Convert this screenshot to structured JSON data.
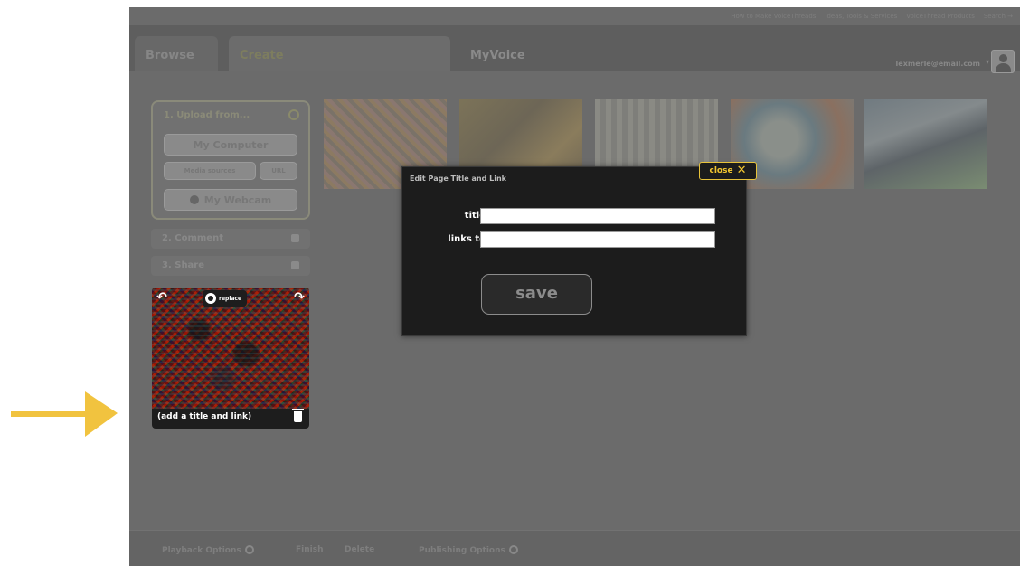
{
  "topbar": {
    "links": [
      "How to Make VoiceThreads",
      "Ideas, Tools & Services",
      "VoiceThread Products",
      "Search →"
    ]
  },
  "tabs": [
    {
      "label": "Browse"
    },
    {
      "label": "Create"
    },
    {
      "label": "MyVoice"
    }
  ],
  "user": {
    "email": "lexmerle@email.com",
    "caret": "▾"
  },
  "upload": {
    "title": "1. Upload from...",
    "my_computer": "My Computer",
    "media_sources": "Media sources",
    "url": "URL",
    "webcam": "My Webcam"
  },
  "steps": {
    "comment": "2. Comment",
    "share": "3. Share"
  },
  "page_card": {
    "replace_label": "replace",
    "caption": "(add a title and link)",
    "arrow_left": "↶",
    "arrow_right": "↷"
  },
  "bottombar": {
    "playback": "Playback Options",
    "finish": "Finish",
    "delete": "Delete",
    "publishing": "Publishing Options"
  },
  "dialog": {
    "title": "Edit Page Title and Link",
    "close_label": "close",
    "close_glyph": "✕",
    "title_label": "title:",
    "links_label": "links to:",
    "title_value": "",
    "links_value": "",
    "save_label": "save"
  },
  "colors": {
    "accent_yellow": "#f2c630",
    "pointer_arrow": "#f1c33f",
    "dialog_bg": "#1c1c1c",
    "app_dimmed": "#6b6b6b"
  },
  "icons": [
    "close-icon",
    "trash-icon",
    "rotate-left-icon",
    "rotate-right-icon",
    "replace-icon",
    "gear-icon",
    "user-avatar-icon",
    "plus-circle-icon",
    "webcam-icon",
    "pointer-arrow-icon"
  ]
}
